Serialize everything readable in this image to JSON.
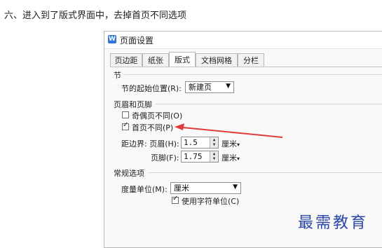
{
  "instruction": "六、进入到了版式界面中，去掉首页不同选项",
  "dialog": {
    "title": "页面设置",
    "close": "×",
    "tabs": [
      "页边距",
      "纸张",
      "版式",
      "文档网格",
      "分栏"
    ],
    "active_tab": "版式"
  },
  "section": {
    "label": "节",
    "start_label": "节的起始位置(R):",
    "start_value": "新建页"
  },
  "header_footer": {
    "label": "页眉和页脚",
    "odd_even_label": "奇偶页不同(O)",
    "odd_even_checked": false,
    "first_page_label": "首页不同(P)",
    "first_page_checked": true,
    "margin_label": "距边界: 页眉(H):",
    "header_value": "1.5",
    "header_unit": "厘米",
    "footer_label": "页脚(F):",
    "footer_value": "1.75",
    "footer_unit": "厘米"
  },
  "general": {
    "label": "常规选项",
    "measure_label": "度量单位(M):",
    "measure_value": "厘米",
    "char_unit_label": "使用字符单位(C)",
    "char_unit_checked": true
  },
  "watermark": "最需教育",
  "colors": {
    "arrow": "#e03a3a",
    "watermark": "#2b46a8",
    "accent": "#2d77d6"
  }
}
